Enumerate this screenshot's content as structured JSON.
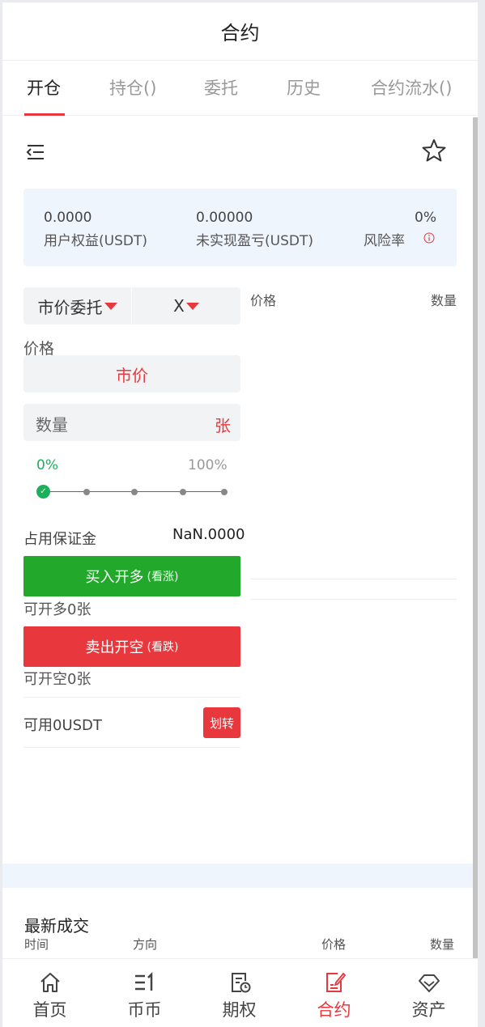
{
  "header": {
    "title": "合约"
  },
  "tabs": [
    {
      "label": "开仓",
      "active": true
    },
    {
      "label": "持仓()"
    },
    {
      "label": "委托"
    },
    {
      "label": "历史"
    },
    {
      "label": "合约流水()"
    }
  ],
  "toolbar": {
    "menu_icon": "collapse-menu-icon",
    "favorite_icon": "star-icon"
  },
  "summary": {
    "equity_value": "0.0000",
    "equity_label": "用户权益(USDT)",
    "unrealized_value": "0.00000",
    "unrealized_label": "未实现盈亏(USDT)",
    "risk_value": "0%",
    "risk_label": "风险率",
    "risk_icon": "info-icon"
  },
  "order_form": {
    "order_type": "市价委托",
    "leverage": "X",
    "price_label": "价格",
    "price_value": "市价",
    "quantity_placeholder": "数量",
    "quantity_unit": "张",
    "percent_min": "0%",
    "percent_max": "100%",
    "slider_value": 0,
    "margin_label": "占用保证金",
    "margin_value": "NaN.0000",
    "buy_label": "买入开多",
    "buy_sub": "(看涨)",
    "can_long": "可开多0张",
    "sell_label": "卖出开空",
    "sell_sub": "(看跌)",
    "can_short": "可开空0张",
    "available": "可用0USDT",
    "transfer_label": "划转"
  },
  "orderbook": {
    "price_header": "价格",
    "qty_header": "数量"
  },
  "trades": {
    "title": "最新成交",
    "col_time": "时间",
    "col_direction": "方向",
    "col_price": "价格",
    "col_qty": "数量"
  },
  "bottom_nav": [
    {
      "label": "首页",
      "icon": "home-icon"
    },
    {
      "label": "币币",
      "icon": "spot-icon"
    },
    {
      "label": "期权",
      "icon": "options-icon"
    },
    {
      "label": "合约",
      "icon": "contract-icon",
      "active": true
    },
    {
      "label": "资产",
      "icon": "diamond-icon"
    }
  ],
  "colors": {
    "accent_red": "#e8383d",
    "buy_green": "#22a82b",
    "summary_bg": "#eef5fd"
  }
}
